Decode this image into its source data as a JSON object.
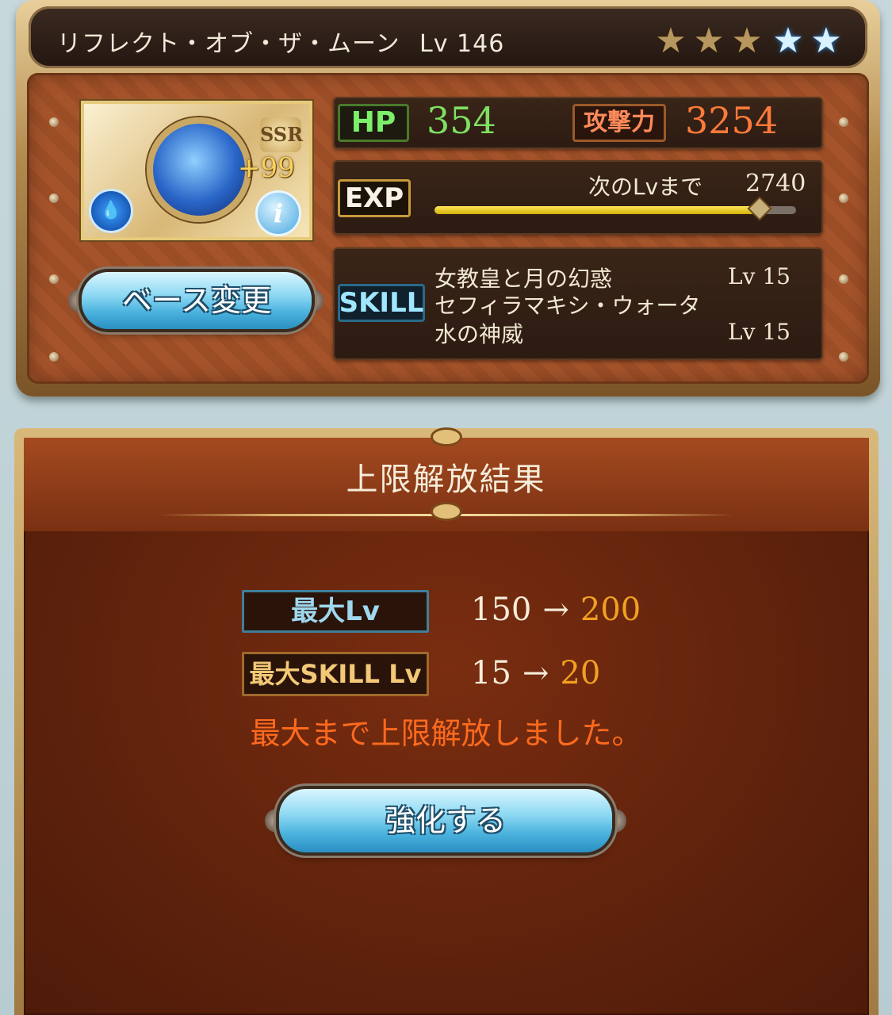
{
  "header": {
    "title": "リフレクト・オブ・ザ・ムーン",
    "level_label": "Lv 146",
    "stars_total": 5,
    "stars_gold": 3,
    "stars_blue": 2
  },
  "card": {
    "rarity": "SSR",
    "plus": "+99",
    "element_icon": "water-icon",
    "info_icon": "i"
  },
  "stats": {
    "hp_label": "HP",
    "hp_value": "354",
    "atk_label": "攻撃力",
    "atk_value": "3254",
    "exp_label": "EXP",
    "next_label": "次のLvまで",
    "next_value": "2740",
    "exp_progress": 0.9
  },
  "skill": {
    "label": "SKILL",
    "name_line1": "女教皇と月の幻惑",
    "level1": "Lv  15",
    "name_line2a": "セフィラマキシ・ウォータ",
    "name_line2b": "水の神威",
    "level2": "Lv  15"
  },
  "buttons": {
    "base_change": "ベース変更",
    "strengthen": "強化する"
  },
  "result": {
    "title": "上限解放結果",
    "max_lv_label": "最大Lv",
    "max_lv_from": "150",
    "max_lv_to": "200",
    "max_skill_label": "最大SKILL Lv",
    "max_skill_from": "15",
    "max_skill_to": "20",
    "arrow": "→",
    "message": "最大まで上限解放しました。"
  },
  "colors": {
    "hp": "#7ee062",
    "atk": "#ff7a3a",
    "exp_bar": "#ffe65a",
    "highlight": "#f2a020",
    "message": "#ff6a1e"
  }
}
